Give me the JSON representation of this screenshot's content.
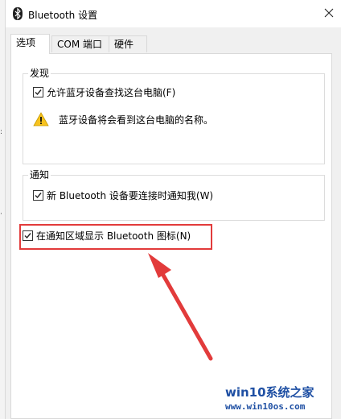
{
  "window": {
    "title": "Bluetooth 设置",
    "bluetooth_icon": "bluetooth-icon",
    "close_icon": "close-icon"
  },
  "tabs": [
    {
      "label": "选项",
      "active": true
    },
    {
      "label": "COM 端口",
      "active": false
    },
    {
      "label": "硬件",
      "active": false
    }
  ],
  "discovery": {
    "legend": "发现",
    "allow_label": "允许蓝牙设备查找这台电脑(F)",
    "allow_checked": true,
    "warning_icon": "warning-icon",
    "warning_text": "蓝牙设备将会看到这台电脑的名称。"
  },
  "notifications": {
    "legend": "通知",
    "notify_label": "新 Bluetooth 设备要连接时通知我(W)",
    "notify_checked": true
  },
  "tray": {
    "show_icon_label": "在通知区域显示 Bluetooth 图标(N)",
    "show_icon_checked": true
  },
  "annotation": {
    "highlight_color": "#e23b3b",
    "arrow_color": "#e23b3b"
  },
  "watermark": {
    "logo_text": "win10系统之家",
    "url_text": "www.win10os.com"
  }
}
